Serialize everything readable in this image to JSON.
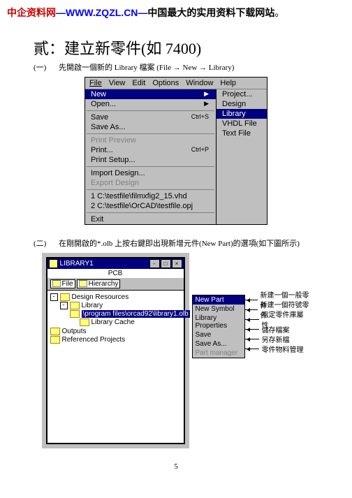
{
  "header": {
    "red": "中企资料网",
    "dash1": "—",
    "blue": "WWW.ZQZL.CN",
    "dash2": "—",
    "black": "中国最大的实用资料下载网站",
    "tail": "。"
  },
  "title": "貳：建立新零件(如 7400)",
  "step1": {
    "num": "(一)",
    "text": "先開啟一個新的 Library 檔案 (File → New → Library)"
  },
  "menu": {
    "top": [
      "File",
      "View",
      "Edit",
      "Options",
      "Window",
      "Help"
    ],
    "col1": [
      {
        "label": "New",
        "hot": "",
        "arrow": true,
        "sel": true
      },
      {
        "label": "Open...",
        "hot": "",
        "arrow": true
      },
      {
        "sep": true
      },
      {
        "label": "Save",
        "hot": "Ctrl+S"
      },
      {
        "label": "Save As...",
        "hot": ""
      },
      {
        "sep": true
      },
      {
        "label": "Print Preview",
        "dis": true
      },
      {
        "label": "Print...",
        "hot": "Ctrl+P"
      },
      {
        "label": "Print Setup...",
        "hot": ""
      },
      {
        "sep": true
      },
      {
        "label": "Import Design...",
        "hot": ""
      },
      {
        "label": "Export Design",
        "dis": true
      },
      {
        "sep": true
      },
      {
        "label": "1 C:\\testfile\\filmxfig2_15.vhd"
      },
      {
        "label": "2 C:\\testfile\\OrCAD\\testfile.opj"
      },
      {
        "sep": true
      },
      {
        "label": "Exit"
      }
    ],
    "col2": [
      {
        "label": "Project..."
      },
      {
        "label": "Design"
      },
      {
        "label": "Library",
        "sel": true
      },
      {
        "label": "VHDL File"
      },
      {
        "label": "Text File"
      }
    ]
  },
  "step2": {
    "num": "(二)",
    "text": "在剛開啟的*.olb 上按右鍵即出現新增元件(New Part)的選項(如下圖所示)"
  },
  "win2": {
    "title": "LIBRARY1",
    "pcb": "PCB",
    "tabs": [
      "File",
      "Hierarchy"
    ],
    "tree": [
      {
        "ind": 0,
        "pm": "-",
        "fold": true,
        "label": "Design Resources"
      },
      {
        "ind": 1,
        "pm": "-",
        "fold": true,
        "label": "Library"
      },
      {
        "ind": 2,
        "pm": "",
        "fold": true,
        "sel": true,
        "label": "\\program files\\orcad92\\library1.olb"
      },
      {
        "ind": 3,
        "pm": "",
        "fold": true,
        "label": "Library Cache"
      },
      {
        "ind": 0,
        "pm": "",
        "fold": true,
        "label": "Outputs"
      },
      {
        "ind": 0,
        "pm": "",
        "fold": true,
        "label": "Referenced Projects"
      }
    ],
    "ctx": [
      {
        "label": "New Part",
        "sel": true
      },
      {
        "label": "New Symbol"
      },
      {
        "label": "Library Properties"
      },
      {
        "label": "Save"
      },
      {
        "label": "Save As..."
      },
      {
        "label": "Part manager",
        "dis": true
      }
    ],
    "annots": [
      "新建一個一般零件",
      "新建一個符號零件",
      "指定零件庫屬性",
      "儲存檔案",
      "另存新檔",
      "零件物料管理"
    ]
  },
  "pagenum": "5"
}
